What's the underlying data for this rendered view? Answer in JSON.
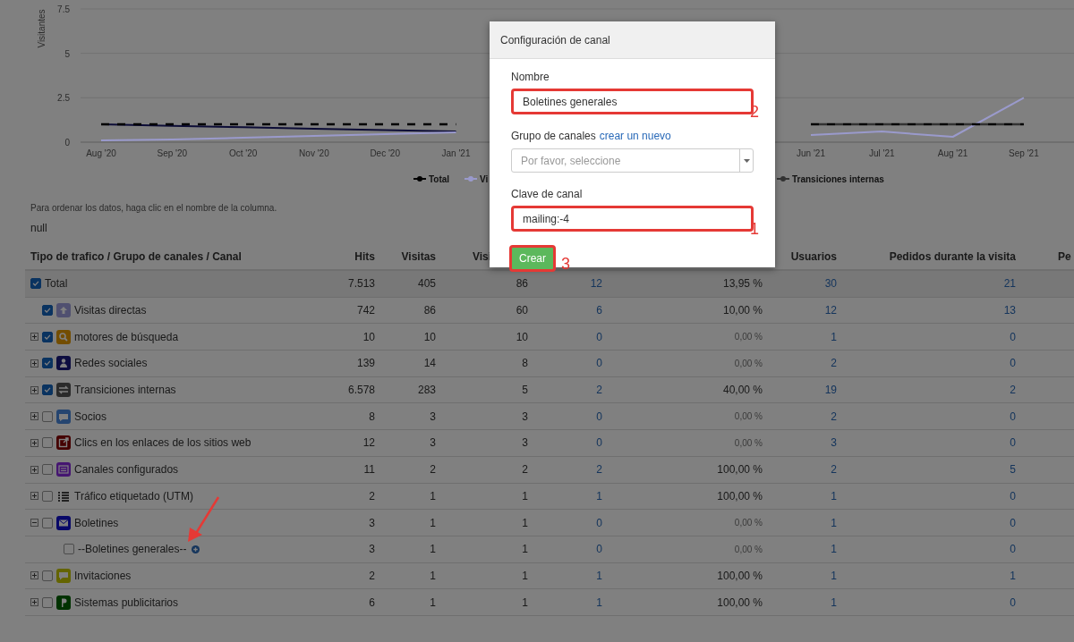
{
  "chart": {
    "chart_data": {
      "type": "line",
      "ylabel": "Visitantes",
      "ylim": [
        0,
        7.5
      ],
      "yticks": [
        0,
        2.5,
        5,
        7.5
      ],
      "grid": true,
      "legend": "bottom",
      "categories": [
        "Aug '20",
        "Sep '20",
        "Oct '20",
        "Nov '20",
        "Dec '20",
        "Jan '21",
        null,
        null,
        null,
        null,
        "Jun '21",
        "Jul '21",
        "Aug '21",
        "Sep '21"
      ],
      "series": [
        {
          "name": "Total",
          "color": "#000000",
          "line_style": "dashed",
          "values": [
            1,
            1,
            1,
            1,
            1,
            1,
            null,
            null,
            null,
            null,
            1,
            1,
            1,
            1
          ]
        },
        {
          "name": "Vi",
          "color": "#9a9acc",
          "line_style": "solid",
          "values": [
            0.1,
            0.15,
            0.25,
            0.35,
            0.45,
            0.55,
            null,
            null,
            null,
            null,
            0.4,
            0.6,
            0.3,
            2.5
          ]
        },
        {
          "name": "Transiciones internas",
          "color": "#333333",
          "line_style": "dashed",
          "values": [
            null,
            null,
            null,
            null,
            null,
            null,
            null,
            null,
            null,
            null,
            1,
            1,
            1,
            1
          ]
        },
        {
          "color": "#0d0d37",
          "line_style": "solid",
          "values": [
            1,
            0.92,
            0.84,
            0.76,
            0.68,
            0.6,
            null,
            null,
            null,
            null,
            null,
            null,
            null,
            null
          ]
        }
      ]
    }
  },
  "sort_hint": "Para ordenar los datos, haga clic en el nombre de la columna.",
  "null_label": "null",
  "table": {
    "columns": [
      {
        "label": "Tipo de trafico / Grupo de canales / Canal",
        "kind": "name"
      },
      {
        "label": "Hits",
        "kind": "number"
      },
      {
        "label": "Visitas",
        "kind": "number"
      },
      {
        "label": "Visi",
        "kind": "cut"
      },
      {
        "kind": "link"
      },
      {
        "kind": "rate"
      },
      {
        "label": "Usuarios",
        "kind": "link"
      },
      {
        "label": "Pedidos durante la visita",
        "kind": "link"
      },
      {
        "label": "Pe",
        "kind": "cut"
      }
    ],
    "rows": [
      {
        "kind": "total",
        "checked": true,
        "cells": [
          "Total",
          "7.513",
          "405",
          "86",
          "12",
          "13,95 %",
          "30",
          "21"
        ],
        "rate_muted": false,
        "children": [
          {
            "kind": "leaf",
            "checked": true,
            "color": "#505070",
            "cells": [
              "Visitas directas",
              "742",
              "86",
              "60",
              "6",
              "10,00 %",
              "12",
              "13"
            ],
            "rate_muted": false
          },
          {
            "kind": "group",
            "checked": true,
            "expanded": false,
            "color": "#734d00",
            "cells": [
              "motores de búsqueda",
              "10",
              "10",
              "10",
              "0",
              "0,00 %",
              "1",
              "0"
            ],
            "rate_muted": true
          },
          {
            "kind": "group",
            "checked": true,
            "expanded": false,
            "color": "#0d0d40",
            "cells": [
              "Redes sociales",
              "139",
              "14",
              "8",
              "0",
              "0,00 %",
              "2",
              "0"
            ],
            "rate_muted": true
          },
          {
            "kind": "group",
            "checked": true,
            "expanded": false,
            "color": "#2b2b2b",
            "cells": [
              "Transiciones internas",
              "6.578",
              "283",
              "5",
              "2",
              "40,00 %",
              "19",
              "2"
            ],
            "rate_muted": false
          },
          {
            "kind": "group",
            "checked": false,
            "expanded": false,
            "color": "#254570",
            "cells": [
              "Socios",
              "8",
              "3",
              "3",
              "0",
              "0,00 %",
              "2",
              "0"
            ],
            "rate_muted": true
          },
          {
            "kind": "group",
            "checked": false,
            "expanded": false,
            "color": "#450000",
            "cells": [
              "Clics en los enlaces de los sitios web",
              "12",
              "3",
              "3",
              "0",
              "0,00 %",
              "3",
              "0"
            ],
            "rate_muted": true
          },
          {
            "kind": "group",
            "checked": false,
            "expanded": false,
            "color": "#451571",
            "cells": [
              "Canales configurados",
              "11",
              "2",
              "2",
              "2",
              "100,00 %",
              "2",
              "5"
            ],
            "rate_muted": false
          },
          {
            "kind": "group",
            "checked": false,
            "expanded": false,
            "color": "#222222",
            "cells": [
              "Tráfico etiquetado (UTM)",
              "2",
              "1",
              "1",
              "1",
              "100,00 %",
              "1",
              "0"
            ],
            "rate_muted": false
          },
          {
            "kind": "group",
            "checked": false,
            "expanded": true,
            "color": "#080868",
            "cells": [
              "Boletines",
              "3",
              "1",
              "1",
              "0",
              "0,00 %",
              "1",
              "0"
            ],
            "rate_muted": true,
            "children": [
              {
                "kind": "channel",
                "checked": false,
                "cells": [
                  "--Boletines generales--",
                  "3",
                  "1",
                  "1",
                  "0",
                  "0,00 %",
                  "1",
                  "0"
                ],
                "rate_muted": true
              }
            ]
          },
          {
            "kind": "group",
            "checked": false,
            "expanded": false,
            "color": "#646400",
            "cells": [
              "Invitaciones",
              "2",
              "1",
              "1",
              "1",
              "100,00 %",
              "1",
              "1"
            ],
            "rate_muted": false
          },
          {
            "kind": "group",
            "checked": false,
            "expanded": false,
            "color": "#003200",
            "cells": [
              "Sistemas publicitarios",
              "6",
              "1",
              "1",
              "1",
              "100,00 %",
              "1",
              "0"
            ],
            "rate_muted": false
          }
        ]
      }
    ]
  },
  "modal": {
    "title": "Configuración de canal",
    "fields": [
      {
        "kind": "text",
        "label": "Nombre",
        "value": "Boletines generales",
        "annotation": "2"
      },
      {
        "kind": "select",
        "label": "Grupo de canales",
        "link": "crear un nuevo",
        "placeholder": "Por favor, seleccione"
      },
      {
        "kind": "text",
        "label": "Clave de canal",
        "value": "mailing:-4",
        "annotation": "1"
      }
    ],
    "button": {
      "label": "Crear",
      "annotation": "3"
    }
  }
}
